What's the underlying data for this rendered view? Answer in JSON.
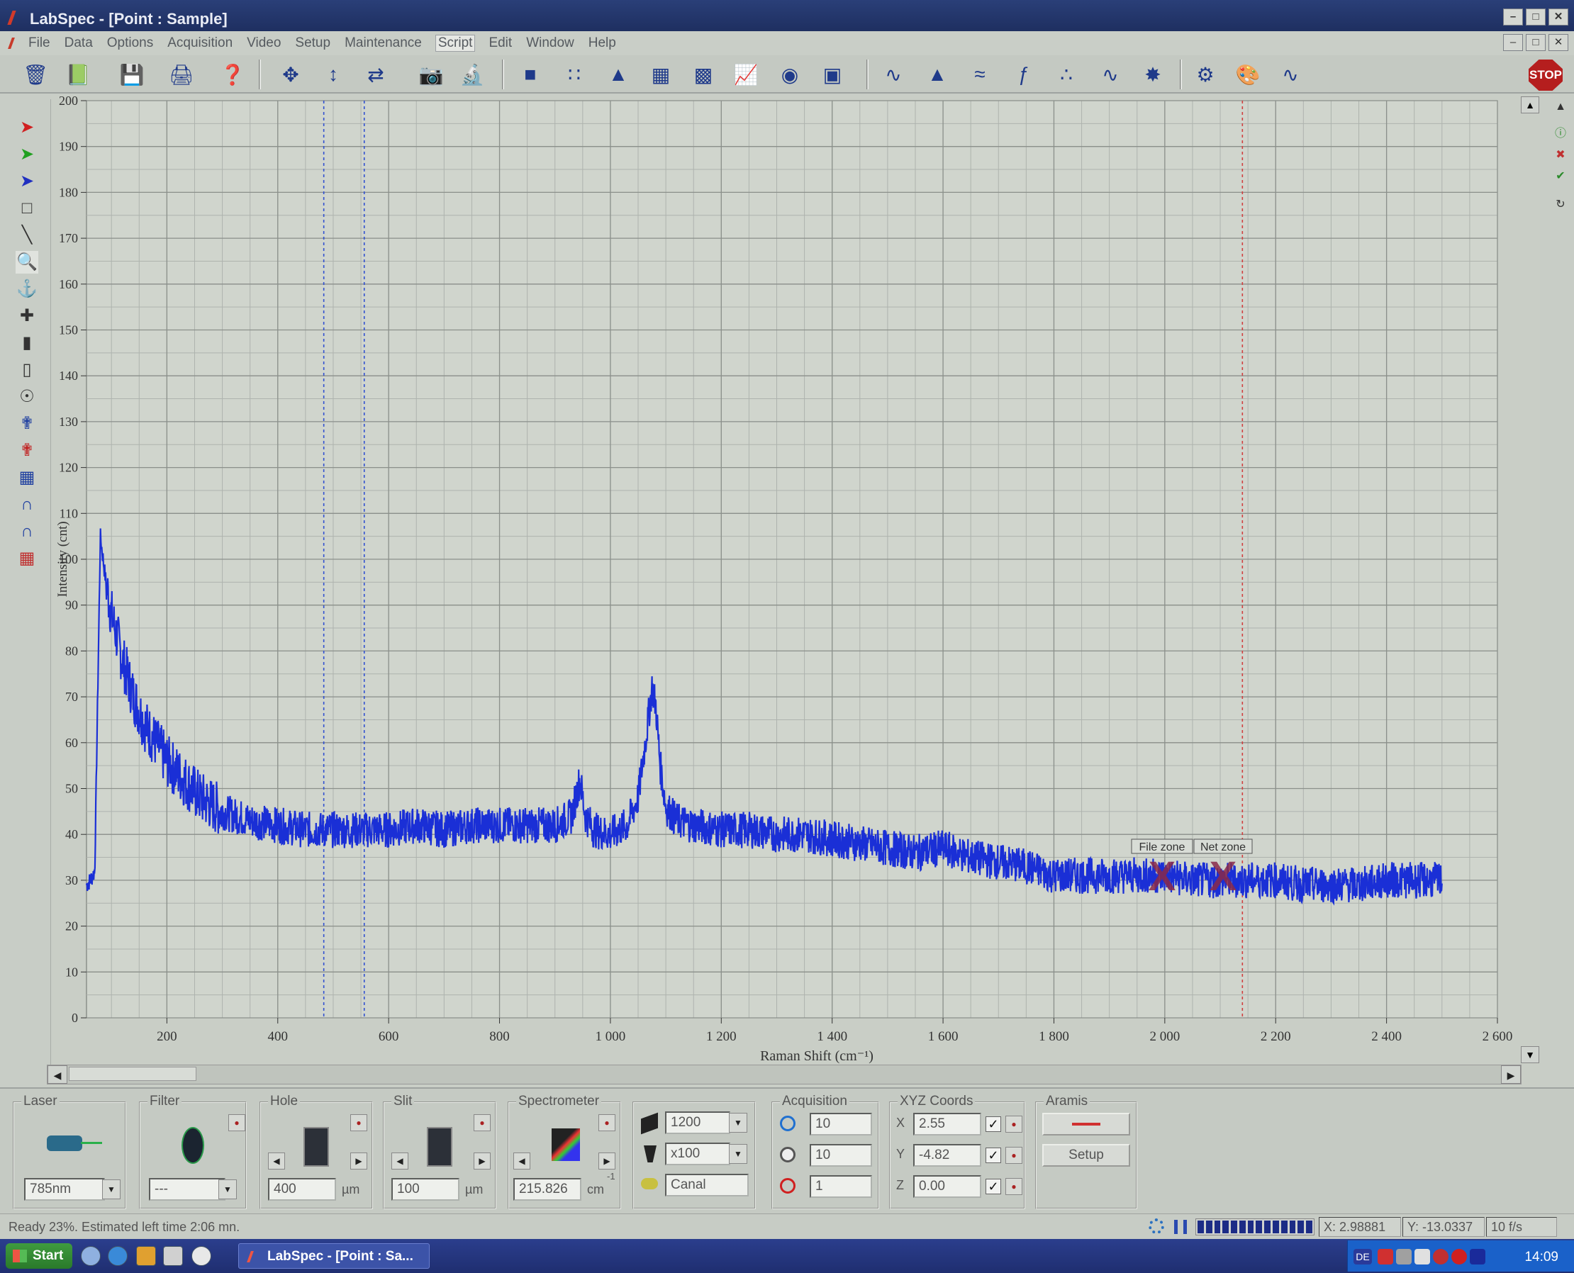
{
  "window": {
    "title": "LabSpec - [Point : Sample]",
    "controls": [
      "–",
      "□",
      "✕"
    ]
  },
  "menu": {
    "items": [
      "File",
      "Data",
      "Options",
      "Acquisition",
      "Video",
      "Setup",
      "Maintenance",
      "Script",
      "Edit",
      "Window",
      "Help"
    ],
    "active": "Script"
  },
  "toolbar": {
    "stop_label": "STOP",
    "icons": [
      "open-icon",
      "book-icon",
      "save-icon",
      "print-icon",
      "help-cursor-icon",
      "zoom-all-icon",
      "zoom-y-icon",
      "zoom-x-icon",
      "camera-icon",
      "microscope-icon",
      "sample-icon",
      "dots-icon",
      "pile-icon",
      "grid-icon",
      "fine-grid-icon",
      "image-icon",
      "cylinder-icon",
      "fit-icon",
      "spectrum-icon",
      "peaks-icon",
      "baseline-icon",
      "ft-icon",
      "ffs-icon",
      "noise-icon",
      "cluster-icon",
      "process-icon",
      "color-icon",
      "overlay-icon"
    ]
  },
  "chart_data": {
    "type": "line",
    "xlabel": "Raman Shift (cm⁻¹)",
    "ylabel": "Intensity (cnt)",
    "xlim": [
      55,
      2600
    ],
    "ylim": [
      0,
      200
    ],
    "x_ticks": [
      200,
      400,
      600,
      800,
      1000,
      1200,
      1400,
      1600,
      1800,
      2000,
      2200,
      2400,
      2600
    ],
    "x_tick_labels": [
      "200",
      "400",
      "600",
      "800",
      "1 000",
      "1 200",
      "1 400",
      "1 600",
      "1 800",
      "2 000",
      "2 200",
      "2 400",
      "2 600"
    ],
    "y_ticks": [
      0,
      10,
      20,
      30,
      40,
      50,
      60,
      70,
      80,
      90,
      100,
      110,
      120,
      130,
      140,
      150,
      160,
      170,
      180,
      190,
      200
    ],
    "grid": true,
    "series": [
      {
        "color": "#1a2fd6",
        "x": [
          55,
          62,
          70,
          80,
          90,
          100,
          120,
          140,
          160,
          180,
          200,
          230,
          260,
          300,
          350,
          400,
          450,
          500,
          550,
          600,
          650,
          700,
          750,
          800,
          850,
          900,
          930,
          945,
          955,
          970,
          1000,
          1030,
          1050,
          1065,
          1075,
          1082,
          1090,
          1100,
          1120,
          1150,
          1200,
          1250,
          1300,
          1350,
          1400,
          1450,
          1500,
          1550,
          1600,
          1650,
          1700,
          1750,
          1800,
          1850,
          1900,
          1950,
          2000,
          2050,
          2100,
          2150,
          2200,
          2250,
          2300,
          2350,
          2400,
          2450,
          2500
        ],
        "y": [
          29,
          30,
          32,
          105,
          95,
          88,
          78,
          70,
          64,
          60,
          56,
          52,
          48,
          45,
          43,
          42,
          41,
          41,
          41,
          41,
          42,
          41,
          42,
          42,
          42,
          42,
          44,
          52,
          44,
          41,
          40,
          42,
          48,
          62,
          72,
          68,
          55,
          46,
          43,
          42,
          41,
          41,
          40,
          40,
          39,
          38,
          37,
          36,
          37,
          35,
          34,
          33,
          31,
          31,
          31,
          31,
          31,
          30,
          30,
          30,
          30,
          29,
          29,
          29,
          30,
          30,
          30
        ]
      }
    ],
    "cursor_lines": [
      {
        "x": 483,
        "color": "#3050d0",
        "style": "dotted"
      },
      {
        "x": 556,
        "color": "#3050d0",
        "style": "dotted"
      },
      {
        "x": 2140,
        "color": "#d04040",
        "style": "dotted"
      }
    ],
    "annotations": [
      "File zone",
      "Net zone"
    ]
  },
  "panel": {
    "laser": {
      "label": "Laser",
      "value": "785nm"
    },
    "filter": {
      "label": "Filter",
      "value": "---"
    },
    "hole": {
      "label": "Hole",
      "value": "400",
      "unit": "µm"
    },
    "slit": {
      "label": "Slit",
      "value": "100",
      "unit": "µm"
    },
    "spectrometer": {
      "label": "Spectrometer",
      "value": "215.826",
      "unit": "cm",
      "unit_sup": "-1"
    },
    "grating": {
      "grating": "1200",
      "objective": "x100",
      "channel": "Canal"
    },
    "acquisition": {
      "label": "Acquisition",
      "accumulations": "10",
      "time": "10",
      "repeat": "1"
    },
    "xyz": {
      "label": "XYZ Coords",
      "x_label": "X",
      "x": "2.55",
      "y_label": "Y",
      "y": "-4.82",
      "z_label": "Z",
      "z": "0.00",
      "check": "✓"
    },
    "aramis": {
      "label": "Aramis",
      "setup": "Setup"
    }
  },
  "status": {
    "message": "Ready 23%. Estimated left time 2:06 mn.",
    "progress": 1.0,
    "x_readout": "X: 2.98881",
    "y_readout": "Y: -13.0337",
    "fps": "10 f/s"
  },
  "taskbar": {
    "start": "Start",
    "task": "LabSpec - [Point : Sa...",
    "lang": "DE",
    "clock": "14:09"
  }
}
